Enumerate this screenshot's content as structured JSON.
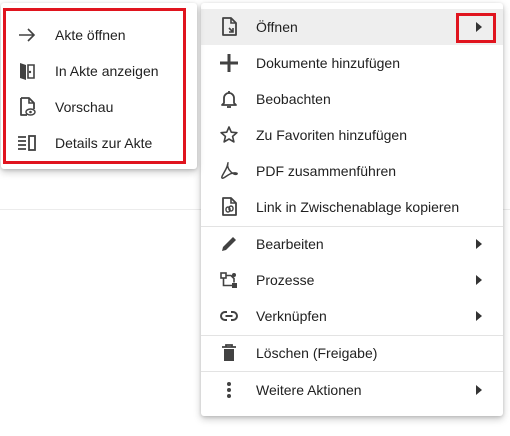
{
  "main_menu": {
    "items": [
      {
        "label": "Öffnen",
        "icon": "file-open-icon",
        "has_submenu": true,
        "active": true
      },
      {
        "label": "Dokumente hinzufügen",
        "icon": "plus-icon",
        "has_submenu": false
      },
      {
        "label": "Beobachten",
        "icon": "bell-icon",
        "has_submenu": false
      },
      {
        "label": "Zu Favoriten hinzufügen",
        "icon": "star-icon",
        "has_submenu": false
      },
      {
        "label": "PDF zusammenführen",
        "icon": "pdf-icon",
        "has_submenu": false
      },
      {
        "label": "Link in Zwischenablage kopieren",
        "icon": "link-file-icon",
        "has_submenu": false
      },
      {
        "label": "Bearbeiten",
        "icon": "pencil-icon",
        "has_submenu": true
      },
      {
        "label": "Prozesse",
        "icon": "process-icon",
        "has_submenu": true
      },
      {
        "label": "Verknüpfen",
        "icon": "link-icon",
        "has_submenu": true
      },
      {
        "label": "Löschen (Freigabe)",
        "icon": "trash-icon",
        "has_submenu": false
      },
      {
        "label": "Weitere Aktionen",
        "icon": "more-vertical-icon",
        "has_submenu": true
      }
    ]
  },
  "sub_menu": {
    "items": [
      {
        "label": "Akte öffnen",
        "icon": "arrow-right-icon"
      },
      {
        "label": "In Akte anzeigen",
        "icon": "book-open-icon"
      },
      {
        "label": "Vorschau",
        "icon": "file-preview-icon"
      },
      {
        "label": "Details zur Akte",
        "icon": "details-list-icon"
      }
    ]
  },
  "colors": {
    "highlight": "#e0141e",
    "active_row": "#eeeeee",
    "icon": "#424242"
  }
}
